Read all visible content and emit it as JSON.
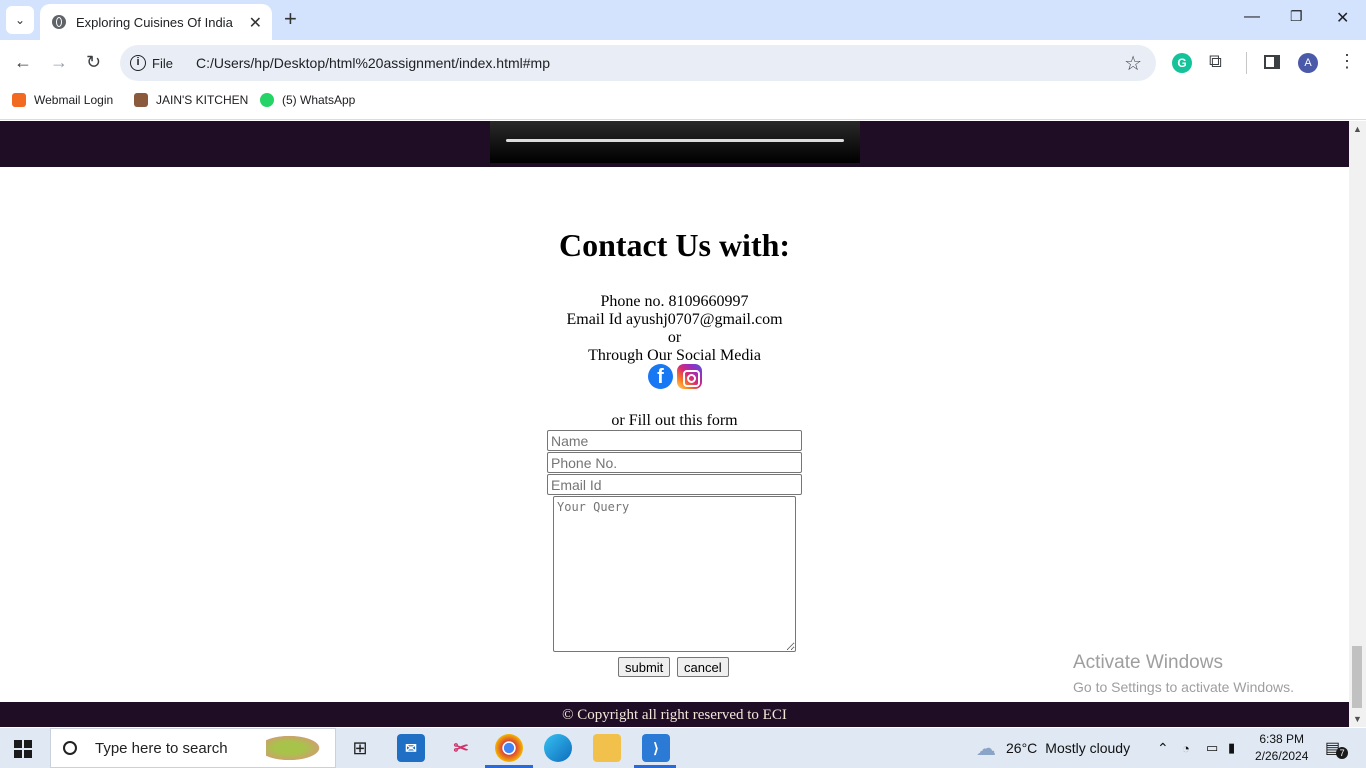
{
  "browser": {
    "tab_title": "Exploring Cuisines Of India",
    "address_prefix": "File",
    "url": "C:/Users/hp/Desktop/html%20assignment/index.html#mp",
    "profile_initial": "A",
    "bookmarks": [
      "Webmail Login",
      "JAIN'S KITCHEN",
      "(5) WhatsApp"
    ]
  },
  "contact": {
    "title": "Contact Us with:",
    "phone": "Phone no. 8109660997",
    "email": "Email Id ayushj0707@gmail.com",
    "or": "or",
    "social_text": "Through Our Social Media",
    "form_prompt": "or Fill out this form",
    "placeholders": {
      "name": "Name",
      "phone": "Phone No.",
      "email": "Email Id",
      "query": "Your Query"
    },
    "submit_label": "submit",
    "cancel_label": "cancel"
  },
  "footer": {
    "copyright": "© Copyright all right reserved to ECI"
  },
  "watermark": {
    "line1": "Activate Windows",
    "line2": "Go to Settings to activate Windows."
  },
  "taskbar": {
    "search_placeholder": "Type here to search",
    "temperature": "26°C",
    "weather": "Mostly cloudy",
    "time": "6:38 PM",
    "date": "2/26/2024",
    "notification_count": "7"
  }
}
